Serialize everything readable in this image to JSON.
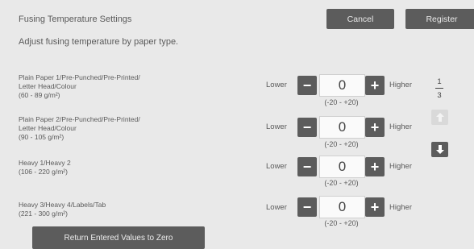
{
  "header": {
    "title": "Fusing Temperature Settings",
    "subtitle": "Adjust fusing temperature by paper type.",
    "cancel_label": "Cancel",
    "register_label": "Register"
  },
  "controls": {
    "lower_label": "Lower",
    "higher_label": "Higher",
    "minus_symbol": "−",
    "plus_symbol": "+"
  },
  "rows": [
    {
      "label_lines": [
        "Plain Paper 1/Pre-Punched/Pre-Printed/",
        "Letter Head/Colour",
        "(60 - 89 g/m²)"
      ],
      "value": "0",
      "range": "(-20 - +20)"
    },
    {
      "label_lines": [
        "Plain Paper 2/Pre-Punched/Pre-Printed/",
        "Letter Head/Colour",
        "(90 - 105 g/m²)"
      ],
      "value": "0",
      "range": "(-20 - +20)"
    },
    {
      "label_lines": [
        "Heavy 1/Heavy 2",
        "(106 - 220 g/m²)"
      ],
      "value": "0",
      "range": "(-20 - +20)"
    },
    {
      "label_lines": [
        "Heavy 3/Heavy 4/Labels/Tab",
        "(221 - 300 g/m²)"
      ],
      "value": "0",
      "range": "(-20 - +20)"
    }
  ],
  "pager": {
    "current": "1",
    "total": "3"
  },
  "icons": {
    "scroll_up": "arrow-up-icon",
    "scroll_down": "arrow-down-icon"
  },
  "footer": {
    "reset_label": "Return Entered Values to Zero"
  },
  "colors": {
    "button": "#5c5c5c",
    "background": "#e9e9e9",
    "disabled": "#d9d9d9"
  }
}
